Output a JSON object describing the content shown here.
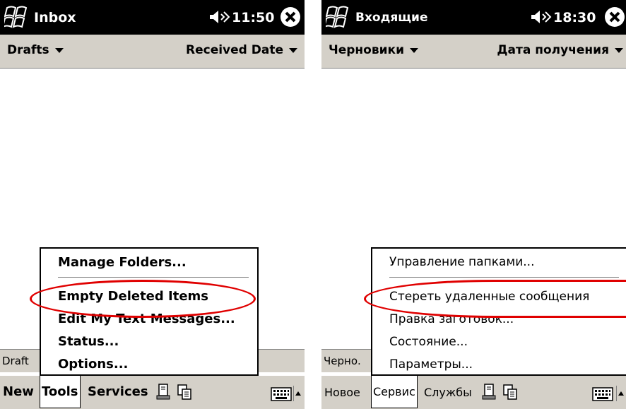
{
  "screens": [
    {
      "title": "Inbox",
      "time": "11:50",
      "folder_menu": "Drafts",
      "sort_menu": "Received Date",
      "status": "Draft",
      "commands": [
        "New",
        "Tools",
        "Services"
      ],
      "menu": [
        "Manage Folders...",
        "Empty Deleted Items",
        "Edit My Text Messages...",
        "Status...",
        "Options..."
      ]
    },
    {
      "title": "Входящие",
      "time": "18:30",
      "folder_menu": "Черновики",
      "sort_menu": "Дата получения",
      "status": "Черно.",
      "commands": [
        "Новое",
        "Сервис",
        "Службы"
      ],
      "menu": [
        "Управление папками...",
        "Стереть удаленные сообщения",
        "Правка заготовок...",
        "Состояние...",
        "Параметры..."
      ]
    }
  ],
  "colors": {
    "highlight_ellipse": "#e00000",
    "titlebar": "#000000",
    "bar": "#d4d0c8"
  },
  "icons": [
    "windows-start-icon",
    "speaker-icon",
    "close-icon",
    "sync-icon",
    "attachment-icon",
    "keyboard-icon",
    "sip-arrow-icon"
  ]
}
